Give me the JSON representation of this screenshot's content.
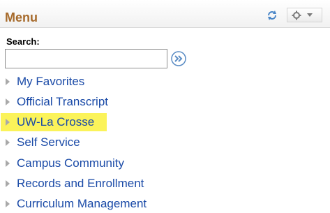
{
  "header": {
    "title": "Menu"
  },
  "search": {
    "label": "Search:",
    "value": ""
  },
  "menu": {
    "items": [
      {
        "label": "My Favorites",
        "highlighted": false
      },
      {
        "label": "Official Transcript",
        "highlighted": false
      },
      {
        "label": "UW-La Crosse",
        "highlighted": true
      },
      {
        "label": "Self Service",
        "highlighted": false
      },
      {
        "label": "Campus Community",
        "highlighted": false
      },
      {
        "label": "Records and Enrollment",
        "highlighted": false
      },
      {
        "label": "Curriculum Management",
        "highlighted": false
      }
    ]
  },
  "colors": {
    "title": "#a66a2b",
    "link": "#1a4aa7",
    "highlight": "#fbf35a"
  },
  "icons": {
    "refresh": "refresh-icon",
    "gear": "gear-icon",
    "go": "go-arrow-icon"
  }
}
